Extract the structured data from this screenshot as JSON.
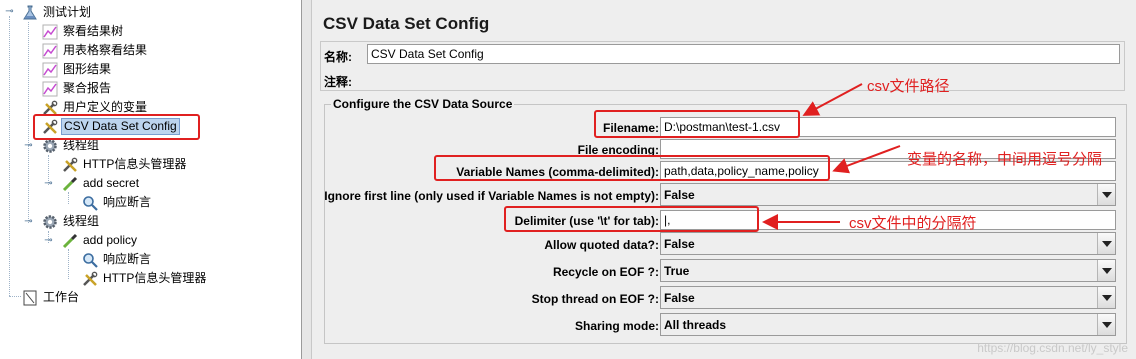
{
  "tree": {
    "root_label": "测试计划",
    "items": [
      {
        "label": "察看结果树",
        "icon": "graph-icon"
      },
      {
        "label": "用表格察看结果",
        "icon": "graph-icon"
      },
      {
        "label": "图形结果",
        "icon": "graph-icon"
      },
      {
        "label": "聚合报告",
        "icon": "graph-icon"
      },
      {
        "label": "用户定义的变量",
        "icon": "wrench-icon"
      },
      {
        "label": "CSV Data Set Config",
        "icon": "wrench-icon",
        "selected": true
      },
      {
        "label": "线程组",
        "icon": "gear-icon"
      },
      {
        "label": "HTTP信息头管理器",
        "icon": "wrench-icon"
      },
      {
        "label": "add secret",
        "icon": "pipette-icon"
      },
      {
        "label": "响应断言",
        "icon": "magnifier-icon"
      },
      {
        "label": "线程组",
        "icon": "gear-icon"
      },
      {
        "label": "add policy",
        "icon": "pipette-icon"
      },
      {
        "label": "响应断言",
        "icon": "magnifier-icon"
      },
      {
        "label": "HTTP信息头管理器",
        "icon": "wrench-icon"
      }
    ],
    "workbench_label": "工作台"
  },
  "panel": {
    "title": "CSV Data Set Config",
    "name_label": "名称:",
    "name_value": "CSV Data Set Config",
    "comment_label": "注释:",
    "comment_value": "",
    "group_title": "Configure the CSV Data Source",
    "fields": {
      "filename": {
        "label": "Filename:",
        "value": "D:\\postman\\test-1.csv"
      },
      "file_encoding": {
        "label": "File encoding:",
        "value": ""
      },
      "variable_names": {
        "label": "Variable Names (comma-delimited):",
        "value": "path,data,policy_name,policy"
      },
      "ignore_first_line": {
        "label": "Ignore first line (only used if Variable Names is not empty):",
        "value": "False"
      },
      "delimiter": {
        "label": "Delimiter (use '\\t' for tab):",
        "value": "|,"
      },
      "allow_quoted": {
        "label": "Allow quoted data?:",
        "value": "False"
      },
      "recycle_eof": {
        "label": "Recycle on EOF ?:",
        "value": "True"
      },
      "stop_thread_eof": {
        "label": "Stop thread on EOF ?:",
        "value": "False"
      },
      "sharing_mode": {
        "label": "Sharing mode:",
        "value": "All threads"
      }
    }
  },
  "annotations": {
    "filename_note": "csv文件路径",
    "variable_note": "变量的名称，中间用逗号分隔",
    "delimiter_note": "csv文件中的分隔符",
    "color": "#e02020"
  },
  "watermark": "https://blog.csdn.net/ly_style"
}
